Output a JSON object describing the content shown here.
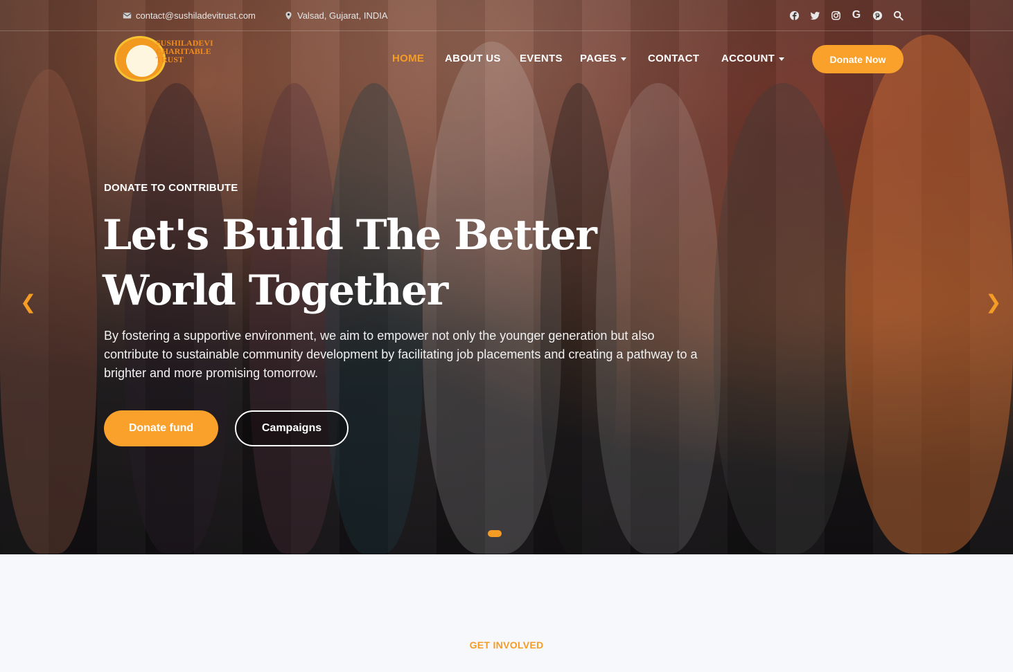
{
  "topbar": {
    "email": "contact@sushiladevitrust.com",
    "location": "Valsad, Gujarat, INDIA",
    "social_icons": [
      "facebook-icon",
      "twitter-icon",
      "instagram-icon",
      "google-icon",
      "pinterest-icon",
      "search-icon"
    ]
  },
  "logo": {
    "line1": "SUSHILADEVI",
    "line2": "CHARITABLE",
    "line3": "TRUST"
  },
  "nav": {
    "items": [
      {
        "label": "HOME",
        "active": true
      },
      {
        "label": "ABOUT US",
        "active": false
      },
      {
        "label": "EVENTS",
        "active": false
      },
      {
        "label": "PAGES",
        "active": false,
        "dropdown": true
      },
      {
        "label": "CONTACT",
        "active": false
      },
      {
        "label": "ACCOUNT",
        "active": false,
        "dropdown": true
      }
    ],
    "cta": "Donate Now"
  },
  "hero": {
    "eyebrow": "DONATE TO CONTRIBUTE",
    "headline_line1": "Let's Build The Better",
    "headline_line2": "World Together",
    "lead": "By fostering a supportive environment, we aim to empower not only the younger generation but also contribute to sustainable community development by facilitating job placements and creating a pathway to a brighter and more promising tomorrow.",
    "primary_button": "Donate fund",
    "secondary_button": "Campaigns",
    "prev_arrow": "❮",
    "next_arrow": "❯"
  },
  "section": {
    "eyebrow": "GET INVOLVED"
  },
  "colors": {
    "accent": "#f9a12b",
    "text_light": "#ffffff"
  }
}
